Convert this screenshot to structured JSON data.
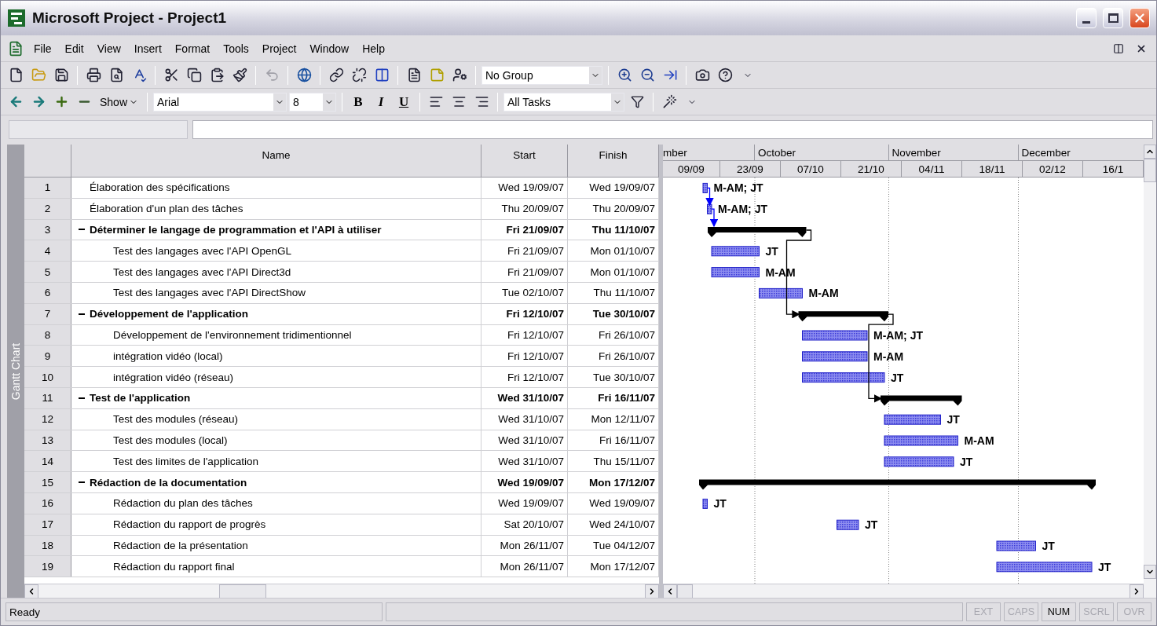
{
  "window": {
    "title": "Microsoft Project - Project1"
  },
  "menu": [
    "File",
    "Edit",
    "View",
    "Insert",
    "Format",
    "Tools",
    "Project",
    "Window",
    "Help"
  ],
  "standard_toolbar": {
    "group": "No Group"
  },
  "formatting_toolbar": {
    "show": "Show",
    "font": "Arial",
    "size": "8",
    "bold": "B",
    "italic": "I",
    "underline": "U",
    "filter": "All Tasks"
  },
  "view_bar": {
    "label": "Gantt Chart"
  },
  "sheet": {
    "columns": [
      "Name",
      "Start",
      "Finish"
    ],
    "rows": [
      {
        "id": "1",
        "name": "Élaboration des spécifications",
        "start": "Wed 19/09/07",
        "finish": "Wed 19/09/07",
        "resources": "M-AM; JT",
        "summary": false
      },
      {
        "id": "2",
        "name": "Élaboration d'un plan des tâches",
        "start": "Thu 20/09/07",
        "finish": "Thu 20/09/07",
        "resources": "M-AM; JT",
        "summary": false
      },
      {
        "id": "3",
        "name": "Déterminer le langage de programmation et l'API à utiliser",
        "start": "Fri 21/09/07",
        "finish": "Thu 11/10/07",
        "summary": true,
        "expanded": true,
        "children": [
          {
            "id": "4",
            "name": "Test des langages avec l'API OpenGL",
            "start": "Fri 21/09/07",
            "finish": "Mon 01/10/07",
            "resources": "JT",
            "summary": false
          },
          {
            "id": "5",
            "name": "Test des langages avec l'API Direct3d",
            "start": "Fri 21/09/07",
            "finish": "Mon 01/10/07",
            "resources": "M-AM",
            "summary": false
          },
          {
            "id": "6",
            "name": "Test des langages avec l'API DirectShow",
            "start": "Tue 02/10/07",
            "finish": "Thu 11/10/07",
            "resources": "M-AM",
            "summary": false
          }
        ]
      },
      {
        "id": "7",
        "name": "Développement de l'application",
        "start": "Fri 12/10/07",
        "finish": "Tue 30/10/07",
        "summary": true,
        "expanded": true,
        "children": [
          {
            "id": "8",
            "name": "Développement de l'environnement tridimentionnel",
            "start": "Fri 12/10/07",
            "finish": "Fri 26/10/07",
            "resources": "M-AM; JT",
            "summary": false
          },
          {
            "id": "9",
            "name": "intégration vidéo (local)",
            "start": "Fri 12/10/07",
            "finish": "Fri 26/10/07",
            "resources": "M-AM",
            "summary": false
          },
          {
            "id": "10",
            "name": "intégration vidéo (réseau)",
            "start": "Fri 12/10/07",
            "finish": "Tue 30/10/07",
            "resources": "JT",
            "summary": false
          }
        ]
      },
      {
        "id": "11",
        "name": "Test de l'application",
        "start": "Wed 31/10/07",
        "finish": "Fri 16/11/07",
        "summary": true,
        "expanded": true,
        "children": [
          {
            "id": "12",
            "name": "Test des modules (réseau)",
            "start": "Wed 31/10/07",
            "finish": "Mon 12/11/07",
            "resources": "JT",
            "summary": false
          },
          {
            "id": "13",
            "name": "Test des modules (local)",
            "start": "Wed 31/10/07",
            "finish": "Fri 16/11/07",
            "resources": "M-AM",
            "summary": false
          },
          {
            "id": "14",
            "name": "Test des limites de l'application",
            "start": "Wed 31/10/07",
            "finish": "Thu 15/11/07",
            "resources": "JT",
            "summary": false
          }
        ]
      },
      {
        "id": "15",
        "name": "Rédaction de la documentation",
        "start": "Wed 19/09/07",
        "finish": "Mon 17/12/07",
        "summary": true,
        "expanded": true,
        "children": [
          {
            "id": "16",
            "name": "Rédaction du plan des tâches",
            "start": "Wed 19/09/07",
            "finish": "Wed 19/09/07",
            "resources": "JT",
            "summary": false
          },
          {
            "id": "17",
            "name": "Rédaction du rapport de progrès",
            "start": "Sat 20/10/07",
            "finish": "Wed 24/10/07",
            "resources": "JT",
            "summary": false
          },
          {
            "id": "18",
            "name": "Rédaction de la présentation",
            "start": "Mon 26/11/07",
            "finish": "Tue 04/12/07",
            "resources": "JT",
            "summary": false
          },
          {
            "id": "19",
            "name": "Rédaction du rapport final",
            "start": "Mon 26/11/07",
            "finish": "Mon 17/12/07",
            "resources": "JT",
            "summary": false
          }
        ]
      }
    ]
  },
  "gantt": {
    "months": [
      "mber",
      "October",
      "November",
      "December"
    ],
    "weeks": [
      "09/09",
      "23/09",
      "07/10",
      "21/10",
      "04/11",
      "18/11",
      "02/12",
      "16/1"
    ],
    "link_arrows": [
      {
        "color": "#0000ff"
      },
      {
        "color": "#0000ff"
      },
      {
        "color": "#000000"
      },
      {
        "color": "#000000"
      }
    ]
  },
  "status_bar": {
    "message": "Ready",
    "indicators": [
      {
        "label": "EXT",
        "on": false
      },
      {
        "label": "CAPS",
        "on": false
      },
      {
        "label": "NUM",
        "on": true
      },
      {
        "label": "SCRL",
        "on": false
      },
      {
        "label": "OVR",
        "on": false
      }
    ]
  }
}
